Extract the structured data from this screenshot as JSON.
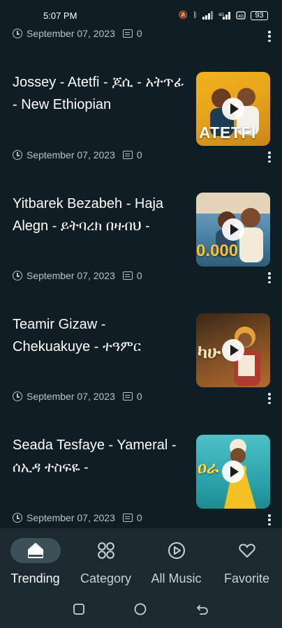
{
  "status_bar": {
    "time": "5:07 PM",
    "battery": "93"
  },
  "videos": [
    {
      "title": "",
      "date": "September 07, 2023",
      "comments": "0"
    },
    {
      "title": "Jossey - Atetfi - ጆሲ - አትጥፊ - New Ethiopian",
      "date": "September 07, 2023",
      "comments": "0",
      "thumb_text": "ATETFI"
    },
    {
      "title": "Yitbarek Bezabeh - Haja Alegn - ይትባረክ በዛብህ -",
      "date": "September 07, 2023",
      "comments": "0",
      "thumb_text": "0.000"
    },
    {
      "title": "Teamir Gizaw - Chekuakuye - ተዓምር",
      "date": "September 07, 2023",
      "comments": "0",
      "thumb_text": "ካሁ"
    },
    {
      "title": "Seada Tesfaye - Yameral - ሰኢዳ ተስፍዬ -",
      "date": "September 07, 2023",
      "comments": "0",
      "thumb_text": "ዐራ"
    }
  ],
  "bottom_nav": [
    {
      "label": "Trending",
      "icon": "home-icon",
      "active": true
    },
    {
      "label": "Category",
      "icon": "grid-icon",
      "active": false
    },
    {
      "label": "All Music",
      "icon": "play-circle-icon",
      "active": false
    },
    {
      "label": "Favorite",
      "icon": "heart-icon",
      "active": false
    }
  ],
  "colors": {
    "background": "#0f1e24",
    "nav_background": "#1a2a30",
    "active_pill": "#3c5058",
    "meta_text": "#b9c3c7"
  }
}
